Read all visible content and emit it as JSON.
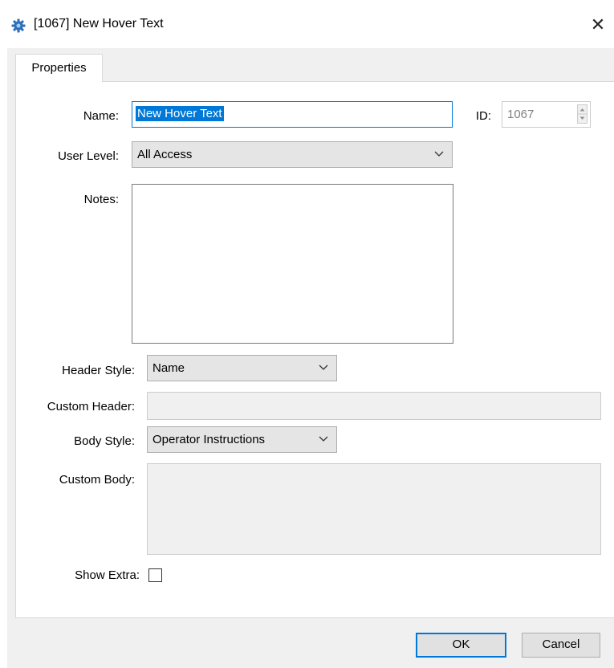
{
  "window": {
    "title": "[1067] New Hover Text",
    "close_glyph": "✕",
    "icon": "gear-icon",
    "accent": "#0078d7"
  },
  "tabs": [
    {
      "label": "Properties",
      "selected": true
    }
  ],
  "form": {
    "name_label": "Name:",
    "name_value": "New Hover Text",
    "id_label": "ID:",
    "id_value": "1067",
    "user_level_label": "User Level:",
    "user_level_value": "All Access",
    "notes_label": "Notes:",
    "notes_value": "",
    "header_style_label": "Header Style:",
    "header_style_value": "Name",
    "custom_header_label": "Custom Header:",
    "custom_header_value": "",
    "body_style_label": "Body Style:",
    "body_style_value": "Operator Instructions",
    "custom_body_label": "Custom Body:",
    "custom_body_value": "",
    "show_extra_label": "Show Extra:",
    "show_extra_checked": false
  },
  "footer": {
    "ok_label": "OK",
    "cancel_label": "Cancel"
  }
}
